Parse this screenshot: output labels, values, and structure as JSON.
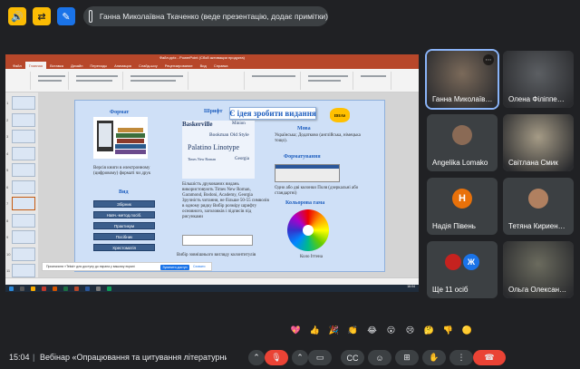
{
  "top_bar": {
    "presenter_label": "Ганна Миколаївна Ткаченко (веде презентацію, додає примітки)"
  },
  "ppt": {
    "window_title": "Файл.pptx - PowerPoint (Сбой активации продукта)",
    "tabs": [
      "Файл",
      "Главная",
      "Вставка",
      "Дизайн",
      "Переходы",
      "Анимация",
      "Слайд-шоу",
      "Рецензирование",
      "Вид",
      "Справка"
    ],
    "slide_numbers": [
      "1",
      "2",
      "3",
      "4",
      "5",
      "6",
      "7",
      "8",
      "9",
      "10",
      "11"
    ],
    "taskbar_time": "16:04",
    "taskbar_date": "22.02.2023"
  },
  "slide": {
    "banner": "Є ідея зробити видання",
    "ideas": "IDEAS",
    "headings": {
      "format": "Формат",
      "font": "Шрифт",
      "mova": "Мова",
      "formatting": "Форматування",
      "vyd": "Вид",
      "color": "Кольорова гама"
    },
    "format_text": "Версія книги в електронному (цифровому) форматі чи друк",
    "font_samples": [
      "Baskerville",
      "Minion",
      "Bookman Old Style",
      "Palatino Linotype",
      "Times New Roman",
      "Georgia"
    ],
    "font_text": "Більшість друкованих видань використовують Times New Roman, Garamond, Bodoni, Academy, Georgia Зручність читання, не більше 50-55 символів в одному рядку Вибір розміру шрифту основного, заголовків і підписів під рисунками",
    "mova_text": "Українська; Додатково (англійська, німецька тощо).",
    "formatting_text": "Одно або дві колонки Поля (дзеркальні або стандартні)",
    "vyd_buttons": [
      "Збірник",
      "Навч.-метод.посіб.",
      "Практикум",
      "Посібник",
      "Хрестоматія"
    ],
    "color_caption": "Коло Іттена",
    "bottom_caption": "Вибір зовнішнього вигляду колонтитулів",
    "infobar_text": "Призначити «Tekst» для доступу до екрана у вашому екрані",
    "infobar_button": "Зупинити доступ",
    "infobar_link": "Сховати"
  },
  "participants": [
    {
      "name": "Ганна Миколаїв…",
      "kind": "photo",
      "color": "#7b6a5a"
    },
    {
      "name": "Олена Філіппе…",
      "kind": "photo",
      "color": "#5c5f63"
    },
    {
      "name": "Angelika Lomako",
      "kind": "avatar",
      "letter": "",
      "color": "#8a6a55"
    },
    {
      "name": "Світлана Смик",
      "kind": "photo",
      "color": "#a59b86"
    },
    {
      "name": "Надія Півень",
      "kind": "avatar",
      "letter": "Н",
      "color": "#e8710a"
    },
    {
      "name": "Тетяна Кириен…",
      "kind": "avatar",
      "letter": "",
      "color": "#b08060"
    },
    {
      "name": "Ще 11 осіб",
      "kind": "group",
      "letter": "Ж",
      "color": "#1a73e8"
    },
    {
      "name": "Ольга Олексан…",
      "kind": "photo",
      "color": "#6b6b5e"
    }
  ],
  "reactions": [
    "💖",
    "👍",
    "🎉",
    "👏",
    "😂",
    "😮",
    "😢",
    "🤔",
    "👎",
    "🟡"
  ],
  "bottom": {
    "time": "15:04",
    "meeting_title": "Вебінар «Опрацювання та цитування літературних…»"
  },
  "controls": [
    {
      "name": "more-up-icon",
      "glyph": "⌃"
    },
    {
      "name": "mic-off-icon",
      "glyph": "🎙"
    },
    {
      "name": "more-up-icon-2",
      "glyph": "⌃"
    },
    {
      "name": "camera-off-icon",
      "glyph": "▭"
    },
    {
      "name": "captions-icon",
      "glyph": "CC"
    },
    {
      "name": "emoji-icon",
      "glyph": "☺"
    },
    {
      "name": "present-icon",
      "glyph": "⊞"
    },
    {
      "name": "hand-icon",
      "glyph": "✋"
    },
    {
      "name": "more-options-icon",
      "glyph": "⋮"
    },
    {
      "name": "hang-up-icon",
      "glyph": "☎"
    }
  ]
}
